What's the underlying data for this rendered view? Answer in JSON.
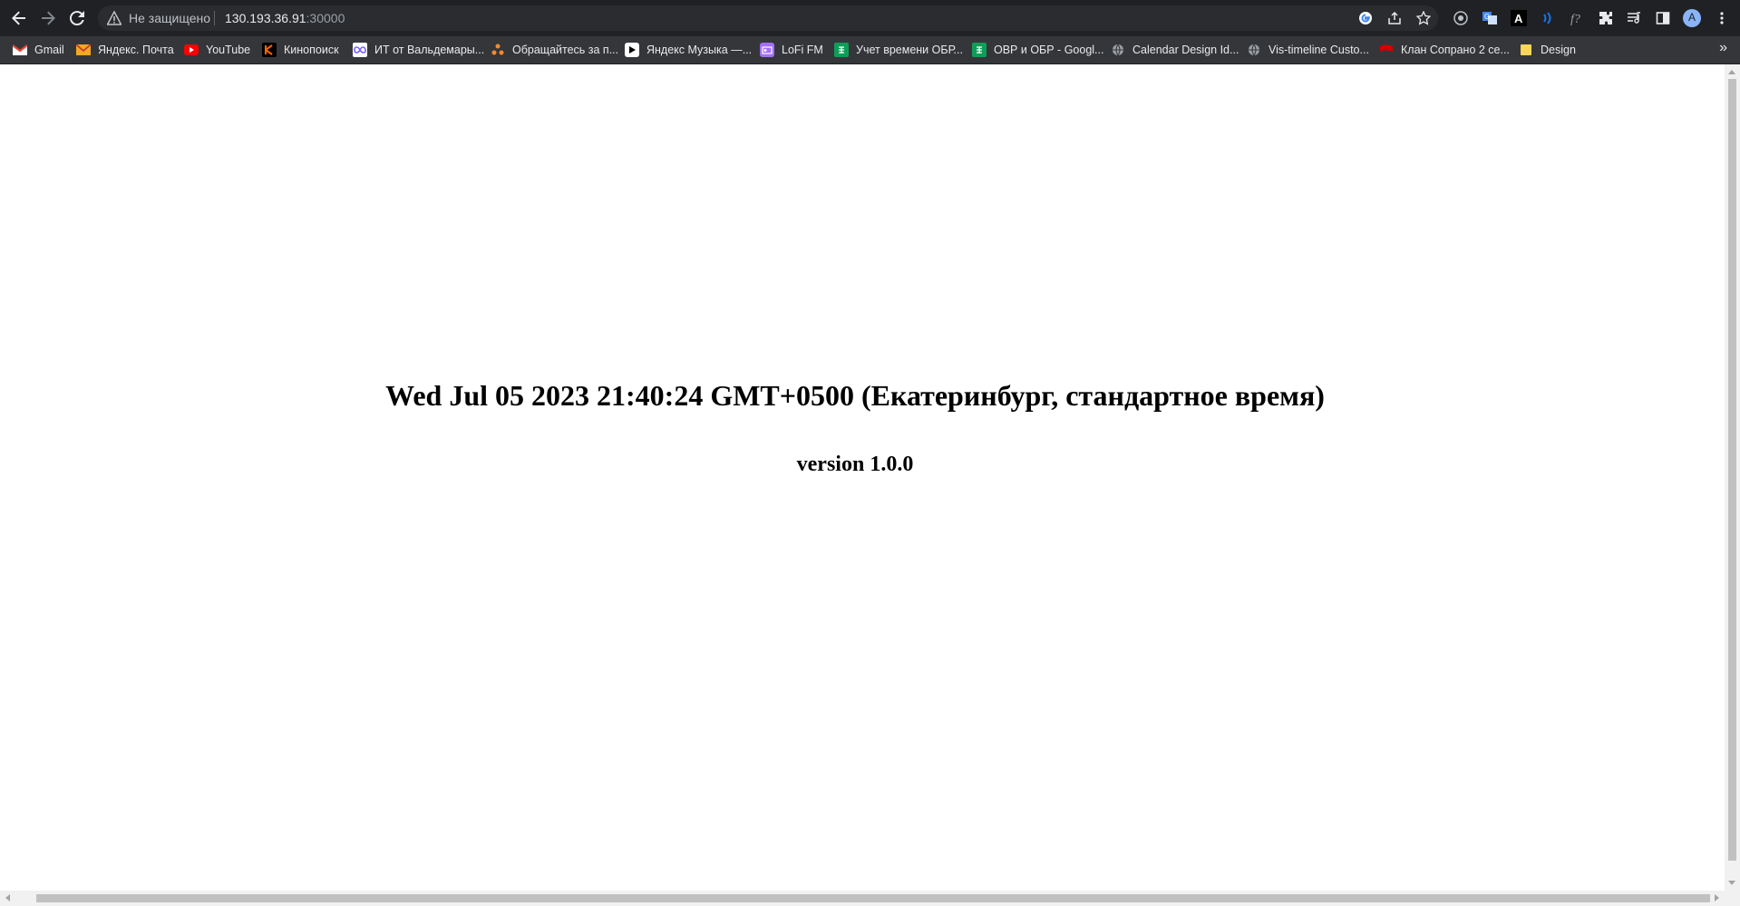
{
  "browser": {
    "address": {
      "security_text": "Не защищено",
      "host": "130.193.36.91",
      "port": ":30000"
    },
    "profile_initial": "A",
    "bookmarks": [
      {
        "label": "Gmail",
        "icon": "gmail-icon",
        "color": "#ea4335"
      },
      {
        "label": "Яндекс. Почта",
        "icon": "mail-envelope-icon",
        "color": "#f5a623"
      },
      {
        "label": "YouTube",
        "icon": "youtube-icon",
        "color": "#ff0000"
      },
      {
        "label": "Кинопоиск",
        "icon": "kinopoisk-icon",
        "color": "#ff6600"
      },
      {
        "label": "ИТ от Вальдемары...",
        "icon": "infinity-icon",
        "color": "#7b61ff"
      },
      {
        "label": "Обращайтесь за п...",
        "icon": "flower-icon",
        "color": "#f28b30"
      },
      {
        "label": "Яндекс Музыка —...",
        "icon": "play-icon",
        "color": "#ffffff"
      },
      {
        "label": "LoFi FM",
        "icon": "radio-icon",
        "color": "#a56eff"
      },
      {
        "label": "Учет времени ОБР...",
        "icon": "sheets-icon",
        "color": "#0f9d58"
      },
      {
        "label": "ОВР и ОБР - Googl...",
        "icon": "sheets-icon",
        "color": "#0f9d58"
      },
      {
        "label": "Calendar Design Id...",
        "icon": "globe-icon",
        "color": "#9aa0a6"
      },
      {
        "label": "Vis-timeline Custo...",
        "icon": "globe-icon",
        "color": "#9aa0a6"
      },
      {
        "label": "Клан Сопрано 2 се...",
        "icon": "flag-icon",
        "color": "#d50000"
      },
      {
        "label": "Design",
        "icon": "folder-icon",
        "color": "#f9d65b"
      }
    ],
    "more_bookmarks": "»"
  },
  "page": {
    "datetime": "Wed Jul 05 2023 21:40:24 GMT+0500 (Екатеринбург, стандартное время)",
    "version": "version 1.0.0"
  }
}
